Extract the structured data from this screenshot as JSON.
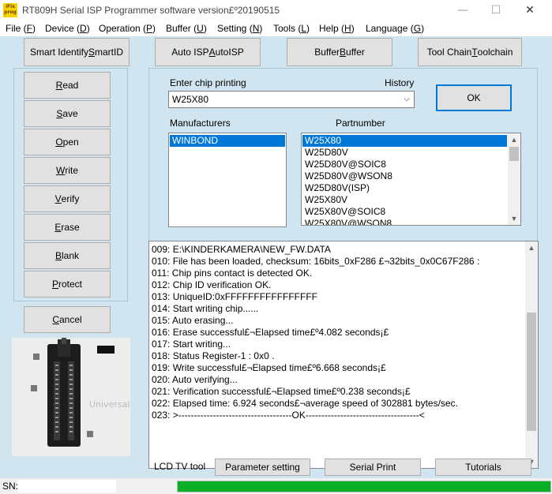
{
  "window": {
    "title": "RT809H Serial ISP Programmer software version£º20190515",
    "icon_text": "iFix prog",
    "minimize_glyph": "—",
    "maximize_glyph": "☐",
    "close_glyph": "✕"
  },
  "menu": [
    {
      "label": "File (",
      "key": "F",
      "suffix": ")"
    },
    {
      "label": "Device (",
      "key": "D",
      "suffix": ")"
    },
    {
      "label": "Operation (",
      "key": "P",
      "suffix": ")"
    },
    {
      "label": "Buffer (",
      "key": "U",
      "suffix": ")"
    },
    {
      "label": "Setting (",
      "key": "N",
      "suffix": ")"
    },
    {
      "label": "Tools (",
      "key": "L",
      "suffix": ")"
    },
    {
      "label": "Help (",
      "key": "H",
      "suffix": ")"
    },
    {
      "label": "Language (",
      "key": "G",
      "suffix": ")"
    }
  ],
  "toolbar": {
    "smart_id": {
      "prefix": "Smart Identify ",
      "u": "S",
      "rest": "martID"
    },
    "auto_isp": {
      "prefix": "Auto ISP ",
      "u": "A",
      "rest": "utoISP"
    },
    "buffer": {
      "prefix": "Buffer ",
      "u": "B",
      "rest": "uffer"
    },
    "toolchain": {
      "prefix": "Tool Chain ",
      "u": "T",
      "rest": "oolchain"
    }
  },
  "ops": [
    {
      "u": "R",
      "rest": "ead"
    },
    {
      "u": "S",
      "rest": "ave"
    },
    {
      "u": "O",
      "rest": "pen"
    },
    {
      "u": "W",
      "rest": "rite"
    },
    {
      "u": "V",
      "rest": "erify"
    },
    {
      "u": "E",
      "rest": "rase"
    },
    {
      "u": "B",
      "rest": "lank"
    },
    {
      "u": "P",
      "rest": "rotect"
    }
  ],
  "cancel": {
    "u": "C",
    "rest": "ancel"
  },
  "chip": {
    "label": "Enter chip printing",
    "history_label": "History",
    "value": "W25X80",
    "ok_label": "OK"
  },
  "manufacturers": {
    "label": "Manufacturers",
    "items": [
      "WINBOND"
    ],
    "selected": 0
  },
  "partnumber": {
    "label": "Partnumber",
    "items": [
      "W25X80",
      "W25D80V",
      "W25D80V@SOIC8",
      "W25D80V@WSON8",
      "W25D80V(ISP)",
      "W25X80V",
      "W25X80V@SOIC8",
      "W25X80V@WSON8"
    ],
    "selected": 0
  },
  "log": [
    "009:  E:\\KINDERKAMERA\\NEW_FW.DATA",
    "010:  File has been loaded, checksum: 16bits_0xF286 £¬32bits_0x0C67F286 :",
    "011:  Chip pins contact is detected OK.",
    "012:  Chip ID verification OK.",
    "013:  UniqueID:0xFFFFFFFFFFFFFFFF",
    "014:  Start writing chip......",
    "015:  Auto erasing...",
    "016:  Erase successful£¬Elapsed time£º4.082 seconds¡£",
    "017:  Start writing...",
    "018:  Status Register-1 : 0x0 .",
    "019:  Write successful£¬Elapsed time£º6.668 seconds¡£",
    "020:  Auto verifying...",
    "021:  Verification successful£¬Elapsed time£º0.238 seconds¡£",
    "022:  Elapsed time: 6.924 seconds£¬average speed of 302881 bytes/sec.",
    "023:  >------------------------------------OK------------------------------------<"
  ],
  "bottom": {
    "lcd_label": "LCD TV tool",
    "parameter": "Parameter setting",
    "serial": "Serial Print",
    "tutorials": "Tutorials"
  },
  "status": {
    "sn_label": "SN:",
    "progress_fraction": 1.0,
    "progress_color": "#06b025"
  },
  "socket_text": "Universal"
}
